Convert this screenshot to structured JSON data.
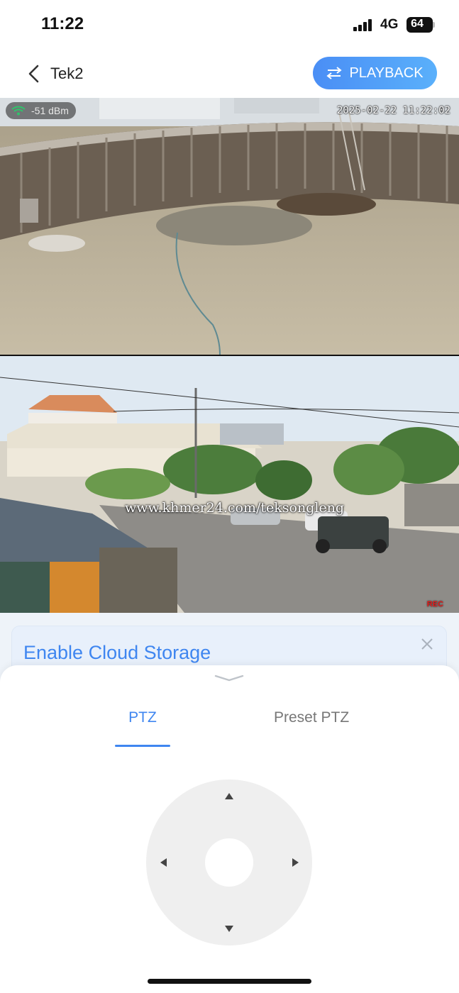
{
  "status_bar": {
    "time": "11:22",
    "network": "4G",
    "battery": "64"
  },
  "header": {
    "device_name": "Tek2",
    "playback_label": "PLAYBACK",
    "accent_color": "#4a8ef5"
  },
  "feeds": {
    "top": {
      "signal": "-51 dBm",
      "timestamp": "2025-02-22 11:22:02"
    },
    "bottom": {
      "watermark": "www.khmer24.com/teksongleng",
      "rec_label": "REC"
    }
  },
  "cloud_banner": {
    "title": "Enable Cloud Storage",
    "close_icon": "close-icon"
  },
  "ptz": {
    "tabs": [
      {
        "label": "PTZ",
        "active": true
      },
      {
        "label": "Preset PTZ",
        "active": false
      }
    ],
    "controls": {
      "up": "arrow-up-icon",
      "down": "arrow-down-icon",
      "left": "arrow-left-icon",
      "right": "arrow-right-icon"
    }
  }
}
